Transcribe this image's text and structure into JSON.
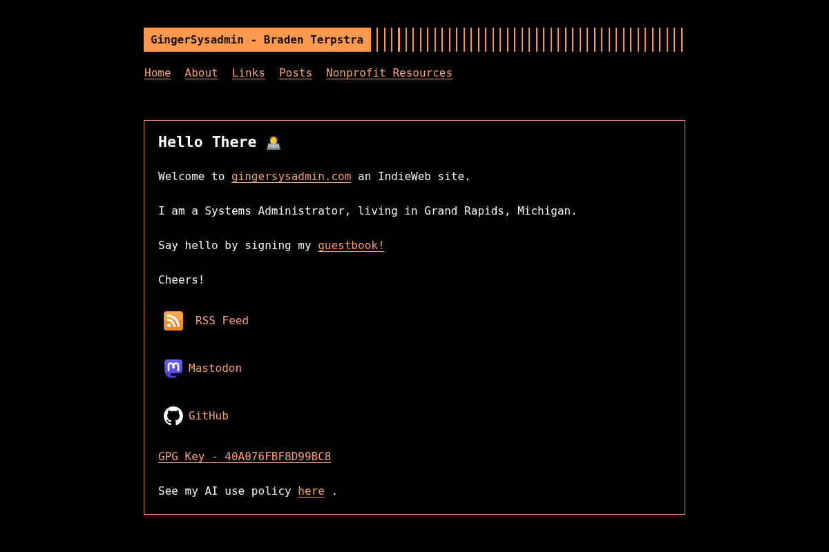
{
  "header": {
    "title": "GingerSysadmin - Braden Terpstra"
  },
  "nav": [
    {
      "label": "Home"
    },
    {
      "label": "About"
    },
    {
      "label": "Links"
    },
    {
      "label": "Posts"
    },
    {
      "label": "Nonprofit Resources"
    }
  ],
  "content": {
    "heading": "Hello There",
    "paragraphs": [
      {
        "before": "Welcome to",
        "link": "gingersysadmin.com",
        "after": "an IndieWeb site."
      },
      {
        "before": "I am a Systems Administrator, living in Grand Rapids, Michigan."
      },
      {
        "before": "Say hello by signing my",
        "link": "guestbook!"
      },
      {
        "before": "Cheers!"
      }
    ],
    "social_links": [
      {
        "kind": "rss",
        "label": "RSS Feed"
      },
      {
        "kind": "mastodon",
        "label": "Mastodon"
      },
      {
        "kind": "github",
        "label": "GitHub"
      }
    ],
    "gpg_link": "GPG Key - 40A076FBF8D99BC8",
    "policy": {
      "before": "See my AI use policy",
      "link": "here",
      "after": "."
    }
  }
}
